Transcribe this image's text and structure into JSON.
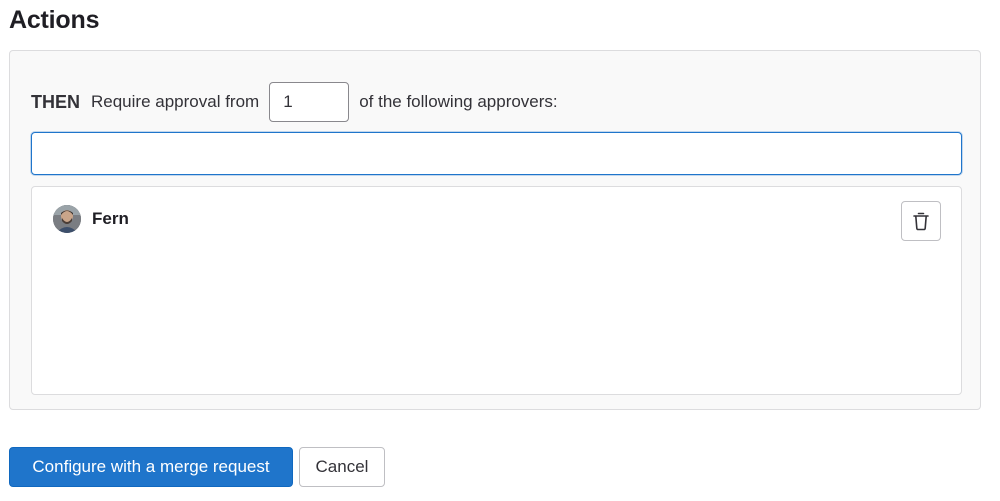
{
  "section": {
    "title": "Actions"
  },
  "rule": {
    "then_label": "THEN",
    "prefix_text": "Require approval from",
    "approvals_required": "1",
    "suffix_text": "of the following approvers:"
  },
  "search": {
    "value": "",
    "placeholder": ""
  },
  "approvers": [
    {
      "name": "Fern",
      "avatar_icon": "user-avatar",
      "action_icon": "trash-icon"
    }
  ],
  "footer": {
    "primary_label": "Configure with a merge request",
    "cancel_label": "Cancel"
  },
  "colors": {
    "primary": "#1f75cb",
    "focus_border": "#1f75cb",
    "panel_bg": "#f9f9f9",
    "border": "#dcdcde"
  }
}
